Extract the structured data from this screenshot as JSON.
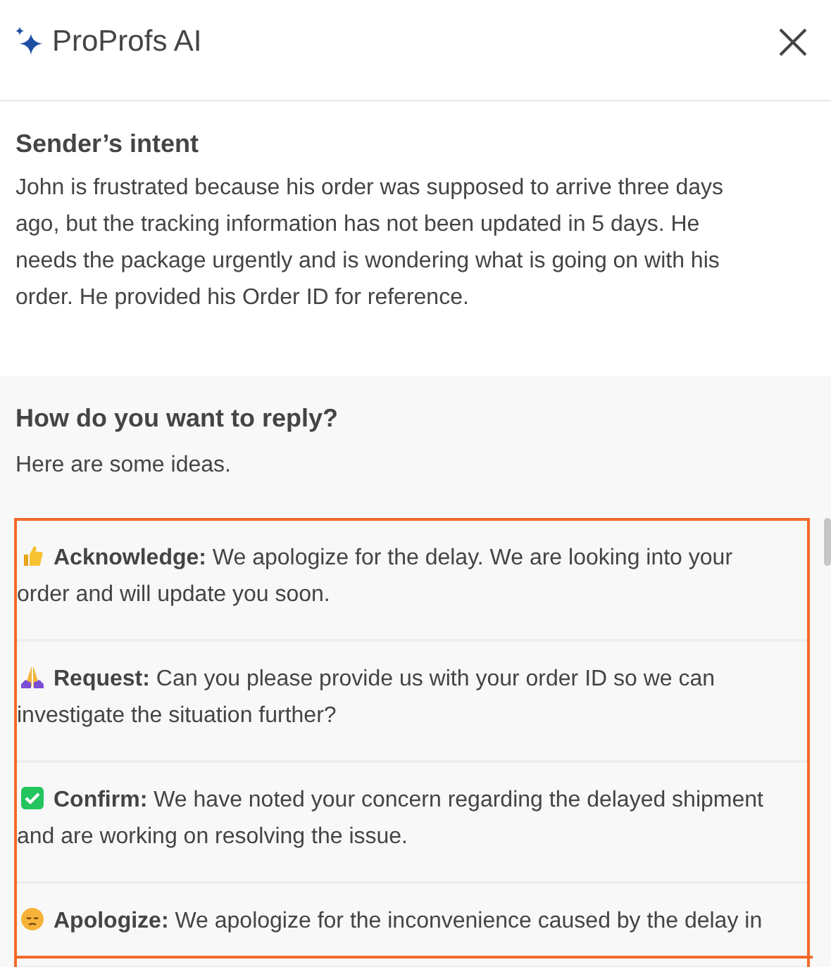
{
  "header": {
    "title": "ProProfs AI"
  },
  "intent": {
    "title": "Sender’s intent",
    "text": "John is frustrated because his order was supposed to arrive three days ago, but the tracking information has not been updated in 5 days. He needs the package urgently and is wondering what is going on with his order. He provided his Order ID for reference."
  },
  "reply": {
    "title": "How do you want to reply?",
    "subtitle": "Here are some ideas.",
    "suggestions": [
      {
        "kind": "thumb",
        "label": "Acknowledge:",
        "text": "We apologize for the delay. We are looking into your order and will update you soon."
      },
      {
        "kind": "hands",
        "label": "Request:",
        "text": "Can you please provide us with your order ID so we can investigate the situation further?"
      },
      {
        "kind": "check",
        "label": "Confirm:",
        "text": "We have noted your concern regarding the delayed shipment and are working on resolving the issue."
      },
      {
        "kind": "face",
        "label": "Apologize:",
        "text": "We apologize for the inconvenience caused by the delay in"
      }
    ]
  }
}
